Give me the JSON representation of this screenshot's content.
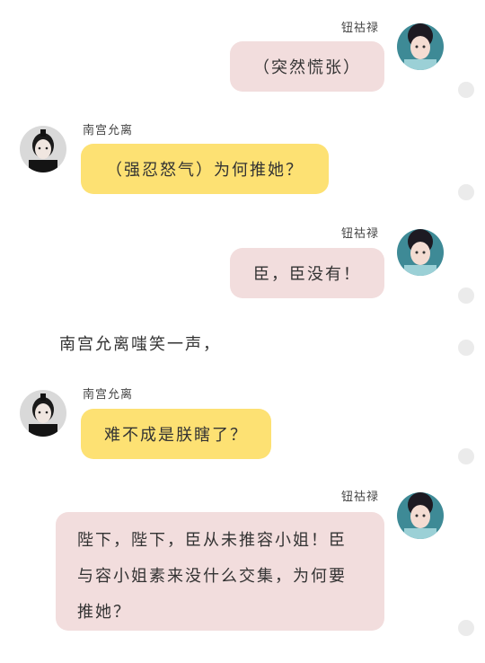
{
  "characters": {
    "female": "钮祜禄",
    "male": "南宫允离"
  },
  "messages": [
    {
      "speaker": "钮祜禄",
      "text": "（突然慌张）"
    },
    {
      "speaker": "南宫允离",
      "text": "（强忍怒气）为何推她？"
    },
    {
      "speaker": "钮祜禄",
      "text": "臣，臣没有！"
    },
    {
      "narration": "南宫允离嗤笑一声，"
    },
    {
      "speaker": "南宫允离",
      "text": "难不成是朕瞎了？"
    },
    {
      "speaker": "钮祜禄",
      "text_lines": [
        "陛下，陛下，臣从未推容小姐！臣",
        "与容小姐素来没什么交集，为何要",
        "推她？"
      ]
    }
  ],
  "colors": {
    "pink_bubble": "#f2dddd",
    "yellow_bubble": "#fde173",
    "dot": "#ebebeb"
  },
  "icons": [
    "female-avatar",
    "male-avatar"
  ]
}
